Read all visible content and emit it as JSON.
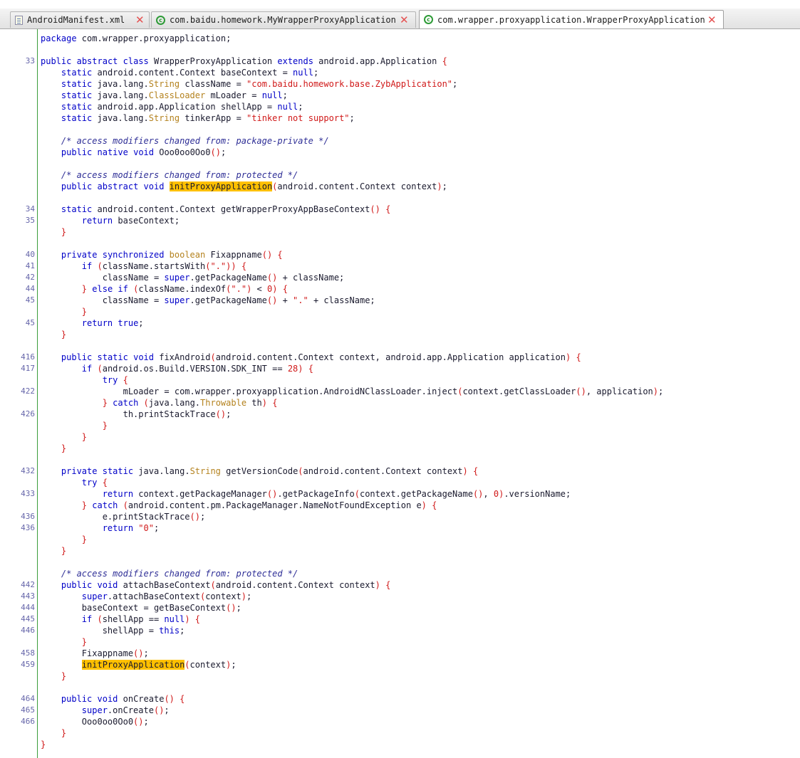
{
  "tabs": [
    {
      "label": "AndroidManifest.xml",
      "icon": "xml-file-icon",
      "active": false
    },
    {
      "label": "com.baidu.homework.MyWrapperProxyApplication",
      "icon": "class-icon",
      "active": false
    },
    {
      "label": "com.wrapper.proxyapplication.WrapperProxyApplication",
      "icon": "class-icon",
      "active": true
    }
  ],
  "colors": {
    "keyword": "#0000c8",
    "string": "#d01818",
    "type": "#b4821e",
    "comment": "#2e2e96",
    "highlight": "#ffc000",
    "gutter": "#3b9d3b"
  },
  "code_lines": [
    {
      "n": "",
      "t": "package com.wrapper.proxyapplication;"
    },
    {
      "n": "",
      "t": ""
    },
    {
      "n": "33",
      "t": "public abstract class WrapperProxyApplication extends android.app.Application {"
    },
    {
      "n": "",
      "t": "    static android.content.Context baseContext = null;"
    },
    {
      "n": "",
      "t": "    static java.lang.String className = \"com.baidu.homework.base.ZybApplication\";"
    },
    {
      "n": "",
      "t": "    static java.lang.ClassLoader mLoader = null;"
    },
    {
      "n": "",
      "t": "    static android.app.Application shellApp = null;"
    },
    {
      "n": "",
      "t": "    static java.lang.String tinkerApp = \"tinker not support\";"
    },
    {
      "n": "",
      "t": ""
    },
    {
      "n": "",
      "t": "    /* access modifiers changed from: package-private */"
    },
    {
      "n": "",
      "t": "    public native void Ooo0oo0Oo0();"
    },
    {
      "n": "",
      "t": ""
    },
    {
      "n": "",
      "t": "    /* access modifiers changed from: protected */"
    },
    {
      "n": "",
      "t": "    public abstract void initProxyApplication(android.content.Context context);"
    },
    {
      "n": "",
      "t": ""
    },
    {
      "n": "34",
      "t": "    static android.content.Context getWrapperProxyAppBaseContext() {"
    },
    {
      "n": "35",
      "t": "        return baseContext;"
    },
    {
      "n": "",
      "t": "    }"
    },
    {
      "n": "",
      "t": ""
    },
    {
      "n": "40",
      "t": "    private synchronized boolean Fixappname() {"
    },
    {
      "n": "41",
      "t": "        if (className.startsWith(\".\")) {"
    },
    {
      "n": "42",
      "t": "            className = super.getPackageName() + className;"
    },
    {
      "n": "44",
      "t": "        } else if (className.indexOf(\".\") < 0) {"
    },
    {
      "n": "45",
      "t": "            className = super.getPackageName() + \".\" + className;"
    },
    {
      "n": "",
      "t": "        }"
    },
    {
      "n": "45",
      "t": "        return true;"
    },
    {
      "n": "",
      "t": "    }"
    },
    {
      "n": "",
      "t": ""
    },
    {
      "n": "416",
      "t": "    public static void fixAndroid(android.content.Context context, android.app.Application application) {"
    },
    {
      "n": "417",
      "t": "        if (android.os.Build.VERSION.SDK_INT == 28) {"
    },
    {
      "n": "",
      "t": "            try {"
    },
    {
      "n": "422",
      "t": "                mLoader = com.wrapper.proxyapplication.AndroidNClassLoader.inject(context.getClassLoader(), application);"
    },
    {
      "n": "",
      "t": "            } catch (java.lang.Throwable th) {"
    },
    {
      "n": "426",
      "t": "                th.printStackTrace();"
    },
    {
      "n": "",
      "t": "            }"
    },
    {
      "n": "",
      "t": "        }"
    },
    {
      "n": "",
      "t": "    }"
    },
    {
      "n": "",
      "t": ""
    },
    {
      "n": "432",
      "t": "    private static java.lang.String getVersionCode(android.content.Context context) {"
    },
    {
      "n": "",
      "t": "        try {"
    },
    {
      "n": "433",
      "t": "            return context.getPackageManager().getPackageInfo(context.getPackageName(), 0).versionName;"
    },
    {
      "n": "",
      "t": "        } catch (android.content.pm.PackageManager.NameNotFoundException e) {"
    },
    {
      "n": "436",
      "t": "            e.printStackTrace();"
    },
    {
      "n": "436",
      "t": "            return \"0\";"
    },
    {
      "n": "",
      "t": "        }"
    },
    {
      "n": "",
      "t": "    }"
    },
    {
      "n": "",
      "t": ""
    },
    {
      "n": "",
      "t": "    /* access modifiers changed from: protected */"
    },
    {
      "n": "442",
      "t": "    public void attachBaseContext(android.content.Context context) {"
    },
    {
      "n": "443",
      "t": "        super.attachBaseContext(context);"
    },
    {
      "n": "444",
      "t": "        baseContext = getBaseContext();"
    },
    {
      "n": "445",
      "t": "        if (shellApp == null) {"
    },
    {
      "n": "446",
      "t": "            shellApp = this;"
    },
    {
      "n": "",
      "t": "        }"
    },
    {
      "n": "458",
      "t": "        Fixappname();"
    },
    {
      "n": "459",
      "t": "        initProxyApplication(context);"
    },
    {
      "n": "",
      "t": "    }"
    },
    {
      "n": "",
      "t": ""
    },
    {
      "n": "464",
      "t": "    public void onCreate() {"
    },
    {
      "n": "465",
      "t": "        super.onCreate();"
    },
    {
      "n": "466",
      "t": "        Ooo0oo0Oo0();"
    },
    {
      "n": "",
      "t": "    }"
    },
    {
      "n": "",
      "t": "}"
    }
  ]
}
